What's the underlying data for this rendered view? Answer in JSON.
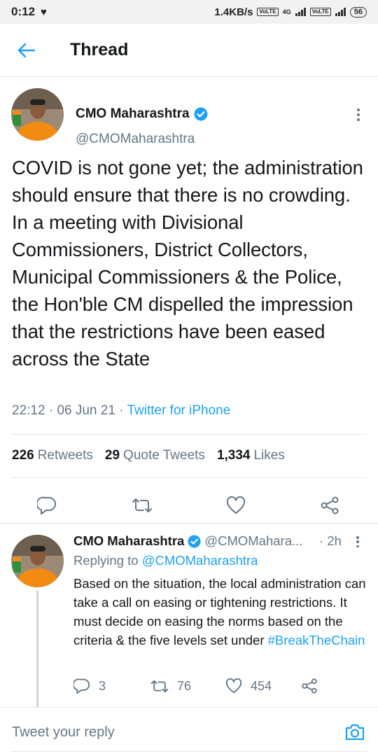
{
  "status_bar": {
    "time": "0:12",
    "speed": "1.4KB/s",
    "network": "4G",
    "volte": "Vo LTE",
    "battery": "56"
  },
  "header": {
    "title": "Thread"
  },
  "main_tweet": {
    "author_name": "CMO Maharashtra",
    "author_handle": "@CMOMaharashtra",
    "text": "COVID is not gone yet; the administration should ensure that there is no crowding. In a meeting with Divisional Commissioners, District Collectors, Municipal Commissioners & the Police, the Hon'ble CM dispelled the impression that the restrictions have been eased across the State",
    "time": "22:12",
    "date": "06 Jun 21",
    "source": "Twitter for iPhone",
    "retweets_count": "226",
    "retweets_label": "Retweets",
    "quote_count": "29",
    "quote_label": "Quote Tweets",
    "likes_count": "1,334",
    "likes_label": "Likes"
  },
  "reply_tweet": {
    "author_name": "CMO Maharashtra",
    "author_handle": "@CMOMahara...",
    "time": "2h",
    "replying_to_label": "Replying to",
    "replying_to_handle": "@CMOMaharashtra",
    "text": "Based on the situation, the local administration can take a call on easing or tightening restrictions. It must decide on easing the norms based on the criteria & the five levels set under",
    "hashtag": "#BreakTheChain",
    "replies": "3",
    "retweets": "76",
    "likes": "454"
  },
  "reply_bar": {
    "placeholder": "Tweet your reply"
  },
  "colors": {
    "accent": "#1da1f2",
    "secondary_text": "#657786",
    "primary_text": "#14171a",
    "divider": "#e1e8ed"
  },
  "icons": [
    "back-arrow-icon",
    "verified-badge-icon",
    "more-vertical-icon",
    "reply-icon",
    "retweet-icon",
    "like-icon",
    "share-icon",
    "camera-icon"
  ]
}
